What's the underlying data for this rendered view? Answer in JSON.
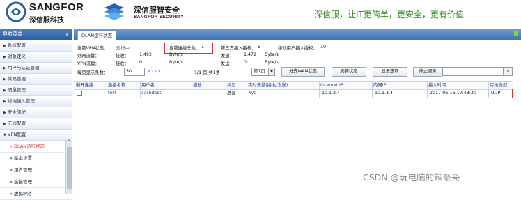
{
  "header": {
    "brand1": "SANGFOR",
    "brand1_sub": "深信服科技",
    "brand2": "深信服智安全",
    "brand2_sub": "SANGFOR SECURITY",
    "slogan": "深信服，让IT更简单，更安全，更有价值"
  },
  "nav": {
    "title": "导航菜单",
    "collapse_icon": "«",
    "items": [
      {
        "label": "系统配置",
        "icon": "triangle-right"
      },
      {
        "label": "对象定义",
        "icon": "triangle-right"
      },
      {
        "label": "用户与认证管理",
        "icon": "triangle-right"
      },
      {
        "label": "策略管理",
        "icon": "triangle-right"
      },
      {
        "label": "流量管理",
        "icon": "triangle-right"
      },
      {
        "label": "终端接入管理",
        "icon": "triangle-right"
      },
      {
        "label": "安全防护",
        "icon": "triangle-right"
      },
      {
        "label": "无线配置",
        "icon": "triangle-right"
      },
      {
        "label": "VPN配置",
        "icon": "triangle-down"
      }
    ],
    "subitems": [
      {
        "label": "DLAN运行状态",
        "active": true
      },
      {
        "label": "基本设置",
        "active": false
      },
      {
        "label": "用户管理",
        "active": false
      },
      {
        "label": "连接管理",
        "active": false
      },
      {
        "label": "虚拟IP池",
        "active": false
      }
    ]
  },
  "tab": {
    "label": "DLAN运行状态"
  },
  "status": {
    "vpn_status_label": "当前VPN状态：",
    "vpn_status_value": "运行中",
    "current_conn_label": "当前连接总数：",
    "current_conn_value": "1",
    "third_party_label": "第三方接入授权：",
    "third_party_value": "5",
    "mobile_label": "移动用户接入授权：",
    "mobile_value": "10",
    "ext_traffic_label": "外网流量：",
    "recv_label": "接收：",
    "recv_ext_value": "1,492",
    "unit": "Byte/s",
    "send_label": "发送：",
    "send_ext_value": "1,472",
    "vpn_traffic_label": "VPN流量：",
    "recv_vpn_value": "0",
    "send_vpn_value": "0"
  },
  "toolbar": {
    "per_page_label": "每页显示条数：",
    "per_page_value": "50",
    "pager_arrows": "« ‹ › »",
    "page_info": "1/1 页  共1条",
    "page_select": "第1页",
    "show_wan_btn": "分支WAN状态",
    "refresh_btn": "刷新状态",
    "options_btn": "显示选项",
    "stop_btn": "停止服务",
    "search_icon": "magnifier"
  },
  "table": {
    "headers": [
      "断开连接",
      "连接名称",
      "用户名",
      "描述",
      "类型",
      "实时流量(接收/发送)",
      "Internet IP",
      "内网IP",
      "接入时间",
      "传输类型"
    ],
    "rows": [
      [
        "",
        "test",
        "cashitest",
        "",
        "总部",
        "0/0",
        "10.1.3.4",
        "10.1.3.4",
        "2017-06-16 17:43:30",
        "UDP"
      ]
    ]
  },
  "watermark": "CSDN @玩电脑的辣条哥"
}
